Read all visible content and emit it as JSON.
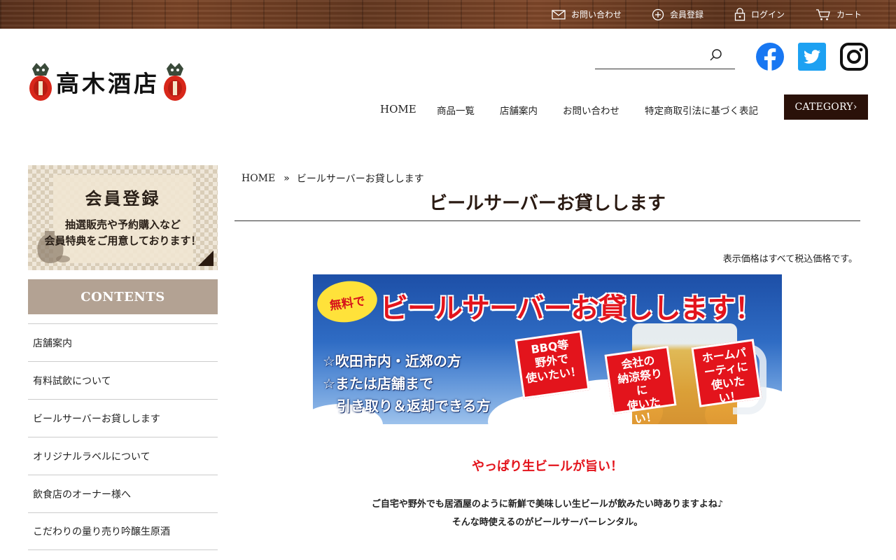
{
  "topbar": {
    "links": [
      {
        "label": "お問い合わせ",
        "icon": "mail-icon"
      },
      {
        "label": "会員登録",
        "icon": "plus-circle-icon"
      },
      {
        "label": "ログイン",
        "icon": "lock-icon"
      },
      {
        "label": "カート",
        "icon": "cart-icon"
      }
    ]
  },
  "header": {
    "logo_text": "高木酒店",
    "search": {
      "placeholder": "",
      "value": ""
    },
    "social": [
      "facebook-icon",
      "twitter-icon",
      "instagram-icon"
    ],
    "nav": [
      "HOME",
      "商品一覧",
      "店舗案内",
      "お問い合わせ",
      "特定商取引法に基づく表記"
    ],
    "category_label": "CATEGORY",
    "category_arrow": "›"
  },
  "sidebar": {
    "banner": {
      "title": "会員登録",
      "line1": "抽選販売や予約購入など",
      "line2": "会員特典をご用意しております！"
    },
    "contents_heading": "CONTENTS",
    "items": [
      "店舗案内",
      "有料試飲について",
      "ビールサーバーお貸しします",
      "オリジナルラベルについて",
      "飲食店のオーナー様へ",
      "こだわりの量り売り吟醸生原酒"
    ]
  },
  "main": {
    "breadcrumb": {
      "home": "HOME",
      "separator": "»",
      "current": "ビールサーバーお貸しします"
    },
    "title": "ビールサーバーお貸しします",
    "tax_note": "表示価格はすべて税込価格です。",
    "hero": {
      "free_badge": "無料で",
      "headline": "ビールサーバーお貸しします！",
      "conditions": [
        "☆吹田市内・近郊の方",
        "☆または店舗まで",
        "引き取り＆返却できる方"
      ],
      "tags": [
        "BBQ等\n野外で\n使いたい！",
        "会社の\n納涼祭りに\n使いたい！",
        "ホームパ\nーティに\n使いたい！"
      ]
    },
    "subheading": "やっぱり生ビールが旨い！",
    "body_lines": [
      "ご自宅や野外でも居酒屋のように新鮮で美味しい生ビールが飲みたい時ありますよね♪",
      "そんな時使えるのがビールサーバーレンタル。"
    ]
  },
  "colors": {
    "category_bg": "#2a1109",
    "contents_bg": "#b3a293",
    "accent_red": "#e3141c",
    "facebook_blue": "#1877f2",
    "twitter_blue": "#1da1f2"
  }
}
